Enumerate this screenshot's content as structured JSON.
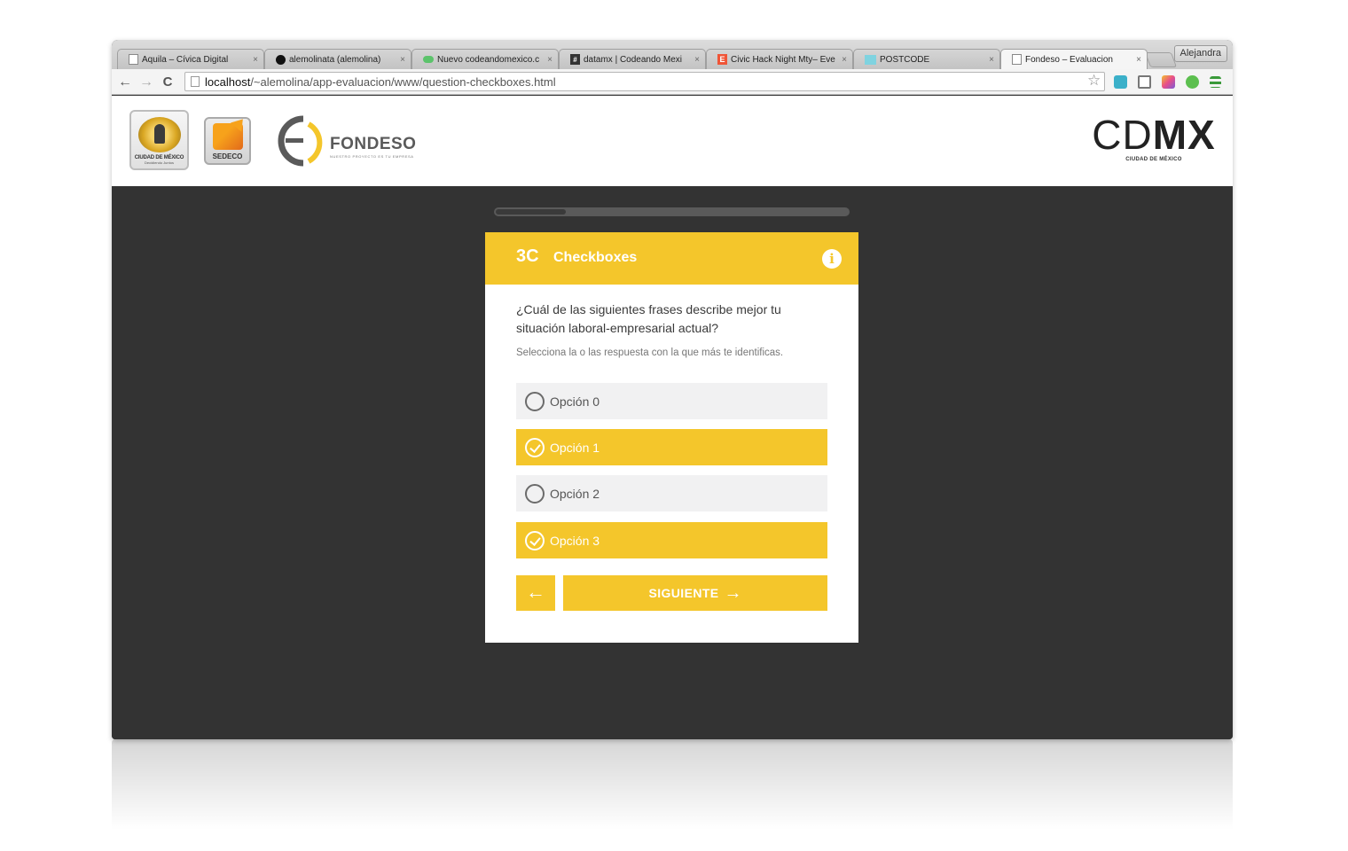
{
  "browser": {
    "tabs": [
      {
        "title": "Aquila – Cívica Digital",
        "icon": "page-icon",
        "active": false
      },
      {
        "title": "alemolinata (alemolina)",
        "icon": "github-icon",
        "active": false
      },
      {
        "title": "Nuevo codeandomexico.c",
        "icon": "cloud-icon",
        "active": false
      },
      {
        "title": "datamx | Codeando Mexi",
        "icon": "hash-icon",
        "active": false
      },
      {
        "title": "Civic Hack Night Mty– Eve",
        "icon": "eventbrite-icon",
        "active": false
      },
      {
        "title": "POSTCODE",
        "icon": "postcode-icon",
        "active": false
      },
      {
        "title": "Fondeso – Evaluacion",
        "icon": "page-icon",
        "active": true
      }
    ],
    "close_glyph": "×",
    "profile_name": "Alejandra",
    "url_host": "localhost",
    "url_path": "/~alemolina/app-evaluacion/www/question-checkboxes.html",
    "nav": {
      "back": "←",
      "forward": "→",
      "reload": "C"
    },
    "star": "☆"
  },
  "header": {
    "seal_text": "CIUDAD DE MÉXICO",
    "seal_sub": "Decidiendo Juntos",
    "sedeco_text": "SEDECO",
    "fondeso_text": "FONDESO",
    "fondeso_sub": "NUESTRO PROYECTO ES TU EMPRESA",
    "cdmx_thin": "CD",
    "cdmx_bold": "MX",
    "cdmx_sub": "CIUDAD DE MÉXICO"
  },
  "progress": {
    "value": 0.2
  },
  "card": {
    "number": "3C",
    "title": "Checkboxes",
    "info_glyph": "i",
    "question": "¿Cuál de las siguientes frases describe mejor tu situación laboral-empresarial actual?",
    "hint": "Selecciona la o las respuesta con la que más te identificas.",
    "options": [
      {
        "label": "Opción 0",
        "checked": false
      },
      {
        "label": "Opción 1",
        "checked": true
      },
      {
        "label": "Opción 2",
        "checked": false
      },
      {
        "label": "Opción 3",
        "checked": true
      }
    ],
    "back_glyph": "←",
    "next_label": "SIGUIENTE",
    "next_glyph": "→"
  },
  "colors": {
    "accent": "#f4c62b",
    "page_bg": "#333333",
    "option_bg": "#f1f1f2"
  }
}
